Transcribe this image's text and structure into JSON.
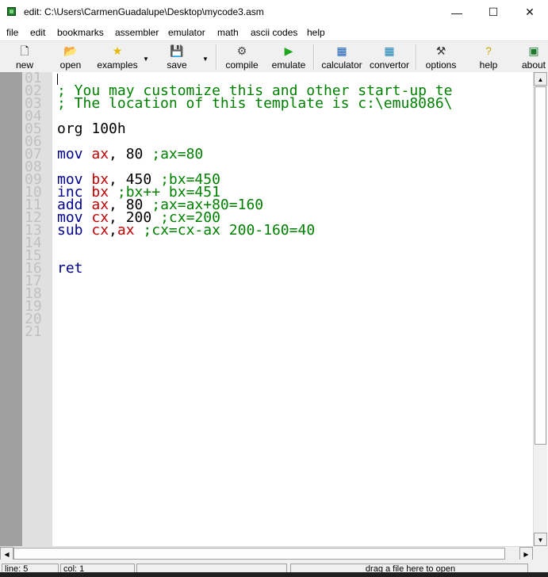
{
  "window": {
    "title": "edit: C:\\Users\\CarmenGuadalupe\\Desktop\\mycode3.asm",
    "minimize": "—",
    "maximize": "☐",
    "close": "✕"
  },
  "menu": [
    "file",
    "edit",
    "bookmarks",
    "assembler",
    "emulator",
    "math",
    "ascii codes",
    "help"
  ],
  "toolbar": {
    "new": "new",
    "open": "open",
    "examples": "examples",
    "save": "save",
    "compile": "compile",
    "emulate": "emulate",
    "calculator": "calculator",
    "convertor": "convertor",
    "options": "options",
    "help": "help",
    "about": "about"
  },
  "line_numbers": [
    "01",
    "02",
    "03",
    "04",
    "05",
    "06",
    "07",
    "08",
    "09",
    "10",
    "11",
    "12",
    "13",
    "14",
    "15",
    "16",
    "17",
    "18",
    "19",
    "20",
    "21"
  ],
  "code": {
    "l02": "; You may customize this and other start-up te",
    "l03": "; The location of this template is c:\\emu8086\\",
    "l05_kw": "org",
    "l05_val": " 100h",
    "l07_kw": "mov",
    "l07_reg": "ax",
    "l07_val": ", 80 ",
    "l07_cm": ";ax=80",
    "l09_kw": "mov",
    "l09_reg": "bx",
    "l09_val": ", 450 ",
    "l09_cm": ";bx=450",
    "l10_kw": "inc",
    "l10_reg": "bx",
    "l10_cm": " ;bx++ bx=451",
    "l11_kw": "add",
    "l11_reg": "ax",
    "l11_val": ", 80 ",
    "l11_cm": ";ax=ax+80=160",
    "l12_kw": "mov",
    "l12_reg": "cx",
    "l12_val": ", 200 ",
    "l12_cm": ";cx=200",
    "l13_kw": "sub",
    "l13_reg": "cx",
    "l13_sep": ",",
    "l13_reg2": "ax",
    "l13_cm": " ;cx=cx-ax 200-160=40",
    "l16_kw": "ret"
  },
  "status": {
    "line": "line: 5",
    "col": "col: 1",
    "drop": "drag a file here to open"
  },
  "colors": {
    "keyword": "#00008b",
    "register": "#c00000",
    "comment": "#008000",
    "gutter": "#e0e0e0"
  }
}
